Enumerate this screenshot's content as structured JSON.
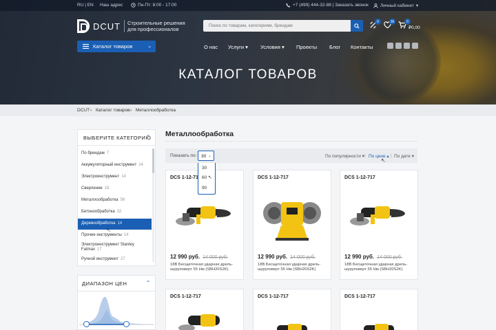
{
  "topbar": {
    "lang": "RU | EN",
    "address": "Наш адрес",
    "hours": "Пн-Пт: 8:00 - 17:00",
    "phone": "+7 (499) 444-32-88 | Заказать звонок",
    "cabinet": "Личный кабинет"
  },
  "header": {
    "logo": "DCUT",
    "tagline1": "Строительные решения",
    "tagline2": "для профессионалов",
    "search_placeholder": "Поиск по товарам, категориям, брендам",
    "compare_count": "0",
    "favorites_count": "36",
    "cart_count": "0",
    "cart_sum": "₽0,00",
    "catalog_button": "Каталог товаров",
    "nav": [
      "О нас",
      "Услуги",
      "Условия",
      "Проекты",
      "Блог",
      "Контакты"
    ],
    "hero_title": "КАТАЛОГ ТОВАРОВ"
  },
  "breadcrumb": [
    "DCUT",
    "Каталог товаров",
    "Металлообработка"
  ],
  "sidebar": {
    "categories_title": "ВЫБЕРИТЕ КАТЕГОРИЮ",
    "items": [
      {
        "label": "По брендам",
        "count": "7"
      },
      {
        "label": "Аккумуляторный инструмент",
        "count": "14"
      },
      {
        "label": "Электроинструмент",
        "count": "14"
      },
      {
        "label": "Сверление",
        "count": "18"
      },
      {
        "label": "Металлообработка",
        "count": "56"
      },
      {
        "label": "Бетонообработка",
        "count": "32"
      },
      {
        "label": "Деревообработка",
        "count": "14"
      },
      {
        "label": "Прочие инструменты",
        "count": "14"
      },
      {
        "label": "Электроинструмент Stanley",
        "label2": "Fatmax",
        "count": "17"
      },
      {
        "label": "Ручной инструмент",
        "count": "27"
      }
    ],
    "active_index": 6,
    "price_title": "ДИАПАЗОН ЦЕН"
  },
  "main": {
    "title": "Металлообработка",
    "show_label": "Показать по:",
    "per_page": "30",
    "per_page_options": [
      "30",
      "60",
      "90"
    ],
    "sort_popular": "По популярности",
    "sort_price": "По цене",
    "sort_date": "По дате",
    "products": [
      {
        "code": "DCS 1-12-717",
        "price": "12 990 руб.",
        "old_price": "14 000 руб.",
        "desc": "18В Бесщеточная ударная дрель-шуруповерт 55 Нм (SBH20S2K)",
        "kind": "grinder"
      },
      {
        "code": "DCS 1-12-717",
        "price": "12 990 руб.",
        "old_price": "14 000 руб.",
        "desc": "18В Бесщеточная ударная дрель-шуруповерт 55 Нм (SBH20S2K)",
        "kind": "bench"
      },
      {
        "code": "DCS 1-12-717",
        "price": "12 990 руб.",
        "old_price": "14 000 руб.",
        "desc": "18В Бесщеточная ударная дрель-шуруповерт 55 Нм (SBH20S2K)",
        "kind": "grinder"
      },
      {
        "code": "DCS 1-12-717",
        "kind": "grinder"
      },
      {
        "code": "DCS 1-12-717",
        "kind": "grinder"
      },
      {
        "code": "DCS 1-12-717",
        "kind": "grinder"
      }
    ]
  },
  "colors": {
    "accent": "#1a5fb4",
    "tool_yellow": "#f2c312"
  }
}
